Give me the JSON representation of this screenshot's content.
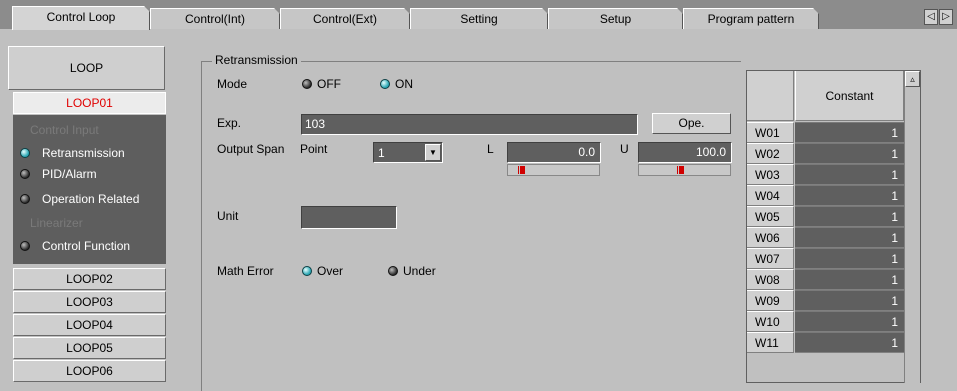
{
  "tabs": [
    "Control Loop",
    "Control(Int)",
    "Control(Ext)",
    "Setting",
    "Setup",
    "Program pattern"
  ],
  "active_tab": "Control Loop",
  "tab_scroll": {
    "left_icon": "triangle-left-icon",
    "right_icon": "triangle-right-icon",
    "left": "◁",
    "right": "▷"
  },
  "sidebar": {
    "header": "LOOP",
    "selected_loop": "LOOP01",
    "sections": [
      {
        "label": "Control Input",
        "enabled": false
      },
      {
        "label": "Retransmission",
        "enabled": true,
        "selected": true
      },
      {
        "label": "PID/Alarm",
        "enabled": true,
        "selected": false
      },
      {
        "label": "Operation Related",
        "enabled": true,
        "selected": false
      },
      {
        "label": "Linearizer",
        "enabled": false
      },
      {
        "label": "Control Function",
        "enabled": true,
        "selected": false
      }
    ],
    "loops": [
      "LOOP02",
      "LOOP03",
      "LOOP04",
      "LOOP05",
      "LOOP06"
    ]
  },
  "retransmission": {
    "group_title": "Retransmission",
    "mode": {
      "label": "Mode",
      "options": [
        "OFF",
        "ON"
      ],
      "selected": "ON"
    },
    "exp": {
      "label": "Exp.",
      "value": "103",
      "button": "Ope."
    },
    "output_span": {
      "label": "Output Span",
      "point_label": "Point",
      "point_value": "1",
      "l_label": "L",
      "l_value": "0.0",
      "u_label": "U",
      "u_value": "100.0"
    },
    "unit": {
      "label": "Unit",
      "value": ""
    },
    "math_error": {
      "label": "Math Error",
      "options": [
        "Over",
        "Under"
      ],
      "selected": "Over"
    }
  },
  "constant_table": {
    "header": "Constant",
    "rows": [
      {
        "name": "W01",
        "value": "1"
      },
      {
        "name": "W02",
        "value": "1"
      },
      {
        "name": "W03",
        "value": "1"
      },
      {
        "name": "W04",
        "value": "1"
      },
      {
        "name": "W05",
        "value": "1"
      },
      {
        "name": "W06",
        "value": "1"
      },
      {
        "name": "W07",
        "value": "1"
      },
      {
        "name": "W08",
        "value": "1"
      },
      {
        "name": "W09",
        "value": "1"
      },
      {
        "name": "W10",
        "value": "1"
      },
      {
        "name": "W11",
        "value": "1"
      }
    ],
    "scroll_up": "▵"
  },
  "colors": {
    "accent_red": "#e00000",
    "led_on": "#2aa7b4",
    "field_dark": "#5f5f5f"
  }
}
